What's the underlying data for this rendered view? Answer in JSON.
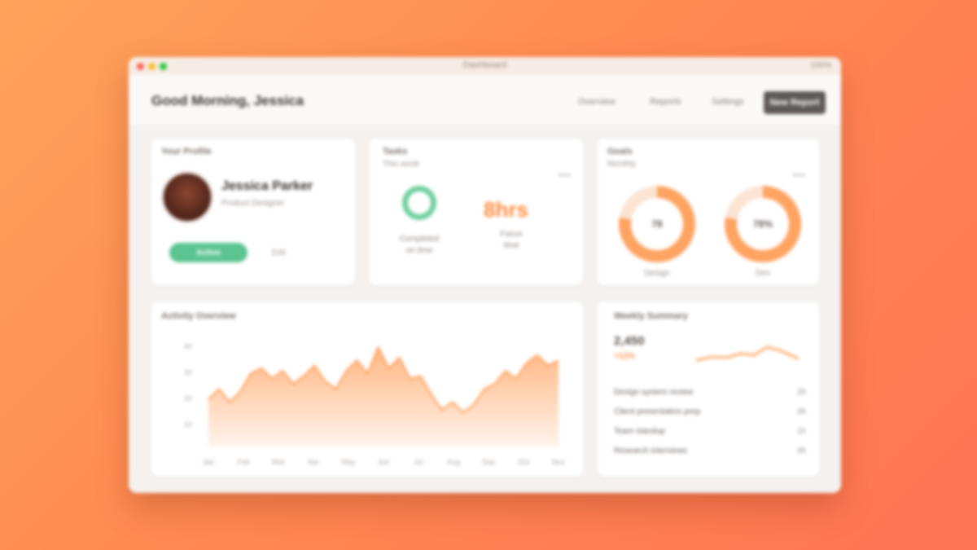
{
  "window": {
    "title": "Dashboard",
    "right_text": "100%"
  },
  "header": {
    "page_title": "Good Morning, Jessica",
    "nav": [
      "Overview",
      "Reports",
      "Settings"
    ],
    "cta_label": "New Report"
  },
  "profile": {
    "section_title": "Your Profile",
    "name": "Jessica Parker",
    "role": "Product Designer",
    "badge": "Active",
    "badge_note": "Edit"
  },
  "stats": {
    "section_title": "Tasks",
    "subtitle": "This week",
    "left_caption_1": "Completed",
    "left_caption_2": "on time",
    "right_value": "8hrs",
    "right_caption_1": "Focus",
    "right_caption_2": "time",
    "accent_green": "#6fcf9f",
    "accent_orange": "#ff8a3d"
  },
  "goals": {
    "section_title": "Goals",
    "subtitle": "Monthly",
    "donuts": [
      {
        "label": "78",
        "caption": "Design",
        "fraction": 0.78
      },
      {
        "label": "78%",
        "caption": "Dev",
        "fraction": 0.78
      }
    ]
  },
  "activity_chart": {
    "section_title": "Activity Overview",
    "chart_data": {
      "type": "area",
      "x": [
        "Jan",
        "Feb",
        "Mar",
        "Apr",
        "May",
        "Jun",
        "Jul",
        "Aug",
        "Sep",
        "Oct",
        "Nov"
      ],
      "y_ticks": [
        "40",
        "30",
        "20",
        "10"
      ],
      "series": [
        {
          "values": [
            18,
            22,
            17,
            21,
            28,
            30,
            26,
            29,
            24,
            27,
            31,
            25,
            22,
            29,
            33,
            28,
            38,
            30,
            34,
            26,
            27,
            20,
            14,
            17,
            13,
            16,
            22,
            24,
            29,
            26,
            32,
            35,
            31,
            33
          ]
        }
      ],
      "ylim": [
        0,
        40
      ],
      "color": "#ffb27a"
    }
  },
  "side": {
    "section_title": "Weekly Summary",
    "metric": "2,450",
    "delta": "+12%",
    "rows": [
      {
        "text": "Design system review",
        "value": "2h"
      },
      {
        "text": "Client presentation prep",
        "value": "3h"
      },
      {
        "text": "Team standup",
        "value": "1h"
      },
      {
        "text": "Research interviews",
        "value": "4h"
      }
    ]
  }
}
